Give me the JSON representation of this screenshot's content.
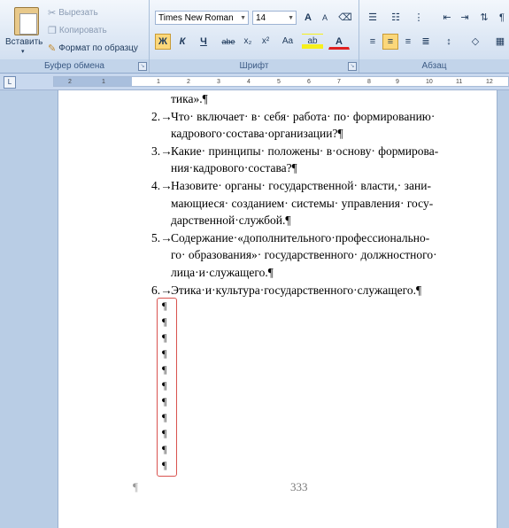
{
  "clipboard": {
    "paste_label": "Вставить",
    "cut_label": "Вырезать",
    "copy_label": "Копировать",
    "format_painter_label": "Формат по образцу",
    "group_label": "Буфер обмена"
  },
  "font": {
    "font_name": "Times New Roman",
    "font_size": "14",
    "group_label": "Шрифт",
    "grow_label": "A",
    "shrink_label": "A",
    "bold_label": "Ж",
    "italic_label": "К",
    "underline_label": "Ч",
    "strike_label": "abe",
    "subscript_label": "x₂",
    "superscript_label": "x²",
    "case_label": "Aa",
    "font_color_label": "A"
  },
  "paragraph": {
    "group_label": "Абзац"
  },
  "ruler": {
    "numbers": [
      "2",
      "1",
      "1",
      "2",
      "3",
      "4",
      "5",
      "6",
      "7",
      "8",
      "9",
      "10",
      "11",
      "12"
    ]
  },
  "document": {
    "fragment": "тика».¶",
    "items": [
      {
        "num": "2.→",
        "lines": [
          "Что· включает· в· себя· работа· по· формированию·",
          "кадрового·состава·организации?¶"
        ]
      },
      {
        "num": "3.→",
        "lines": [
          "Какие· принципы· положены· в·основу· формирова-",
          "ния·кадрового·состава?¶"
        ]
      },
      {
        "num": "4.→",
        "lines": [
          "Назовите· органы· государственной· власти,· зани-",
          "мающиеся· созданием· системы· управления· госу-",
          "дарственной·службой.¶"
        ]
      },
      {
        "num": "5.→",
        "lines": [
          "Содержание·«дополнительного·профессионально-",
          "го· образования»· государственного· должностного·",
          "лица·и·служащего.¶"
        ]
      },
      {
        "num": "6.→",
        "lines": [
          "Этика·и·культура·государственного·служащего.¶"
        ]
      }
    ],
    "empty_marks": [
      "¶",
      "¶",
      "¶",
      "¶",
      "¶",
      "¶",
      "¶",
      "¶",
      "¶",
      "¶",
      "¶"
    ],
    "footer_mark": "¶",
    "page_number": "333"
  }
}
